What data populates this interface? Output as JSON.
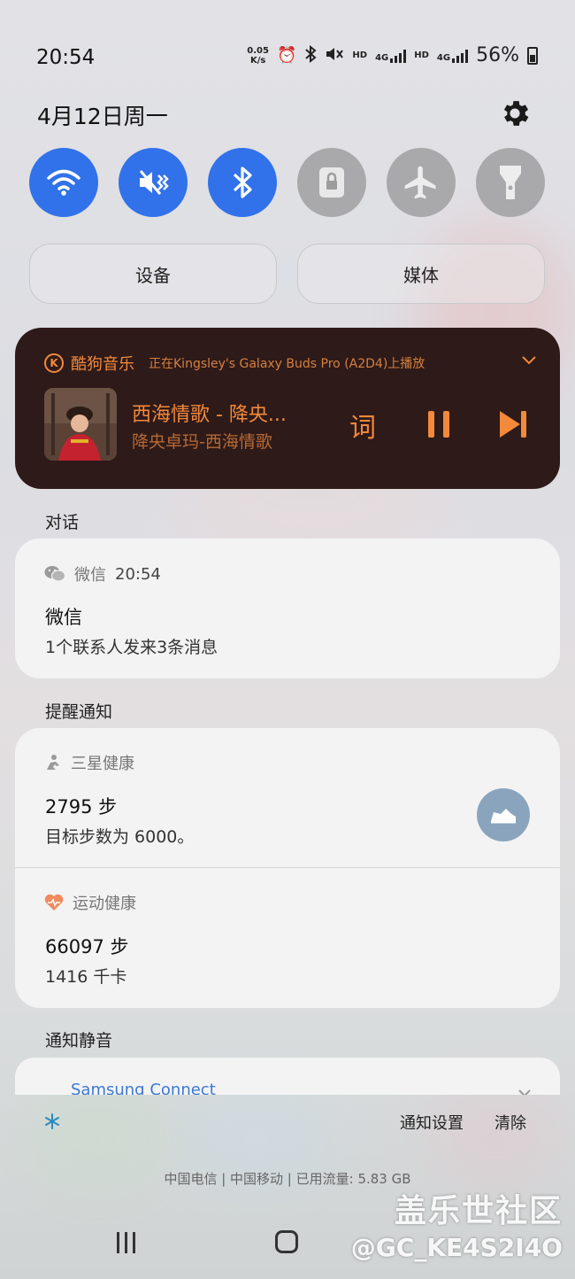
{
  "status_bar": {
    "time": "20:54",
    "net_speed_value": "0.05",
    "net_speed_unit": "K/s",
    "hd1": "HD",
    "net1": "4G",
    "hd2": "HD",
    "net2": "4G",
    "battery": "56%"
  },
  "header": {
    "date": "4月12日周一"
  },
  "quick_settings": {
    "toggles": [
      {
        "icon": "wifi-icon",
        "state": "on"
      },
      {
        "icon": "mute-vibrate-icon",
        "state": "on"
      },
      {
        "icon": "bluetooth-icon",
        "state": "on"
      },
      {
        "icon": "rotation-lock-icon",
        "state": "off"
      },
      {
        "icon": "airplane-icon",
        "state": "off"
      },
      {
        "icon": "flashlight-icon",
        "state": "off"
      }
    ],
    "devices_label": "设备",
    "media_label": "媒体",
    "on_color": "#3172ea",
    "off_color": "#a9a9ab"
  },
  "media": {
    "app_letter": "K",
    "app_name": "酷狗音乐",
    "device_text": "正在Kingsley's Galaxy Buds Pro (A2D4)上播放",
    "title": "西海情歌 - 降央...",
    "subtitle": "降央卓玛-西海情歌",
    "lyrics_label": "词",
    "accent_color": "#f2893b",
    "background_color": "#2e1a19"
  },
  "sections": {
    "conversation": "对话",
    "reminders": "提醒通知",
    "silent": "通知静音"
  },
  "wechat": {
    "app_name": "微信",
    "time": "20:54",
    "title": "微信",
    "text": "1个联系人发来3条消息"
  },
  "samsung_health": {
    "app_name": "三星健康",
    "title": "2795 步",
    "text": "目标步数为 6000。"
  },
  "sports_health": {
    "app_name": "运动健康",
    "title": "66097 步",
    "text": "1416 千卡"
  },
  "silent_notification": {
    "app_name": "Samsung Connect"
  },
  "footer": {
    "notif_settings": "通知设置",
    "clear": "清除",
    "carrier": "中国电信 | 中国移动 | 已用流量: 5.83 GB"
  },
  "watermark": {
    "line1": "盖乐世社区",
    "line2": "@GC_KE4S2I4O"
  }
}
